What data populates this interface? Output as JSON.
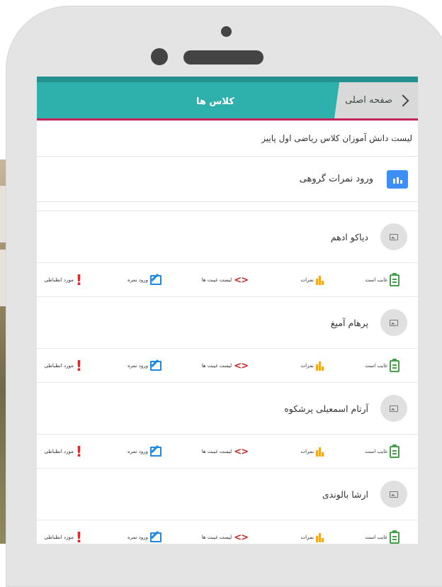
{
  "header": {
    "back_label": "صفحه اصلی",
    "title": "کلاس ها"
  },
  "subtitle": "لیست دانش آموزان کلاس ریاضی اول پاییز",
  "group_entry": {
    "label": "ورود نمرات گروهی"
  },
  "actions": {
    "absent": "غایب است",
    "grades": "نمرات",
    "absence_list": "لیست غیبت ها",
    "enter_grade": "ورود نمره",
    "disciplinary": "مورد انظباطی"
  },
  "students": [
    {
      "name": "دیاکو ادهم"
    },
    {
      "name": "پرهام آمیغ"
    },
    {
      "name": "آرتام اسمعیلی پرشکوه"
    },
    {
      "name": "ارشا بالوندی"
    }
  ],
  "colors": {
    "header_teal": "#2eb0ad",
    "header_accent": "#c2255c",
    "primary_blue": "#3e8ef7",
    "absent_green": "#43a047",
    "grades_orange": "#f5a623",
    "absence_red": "#c62828",
    "edit_blue": "#1e88e5"
  }
}
